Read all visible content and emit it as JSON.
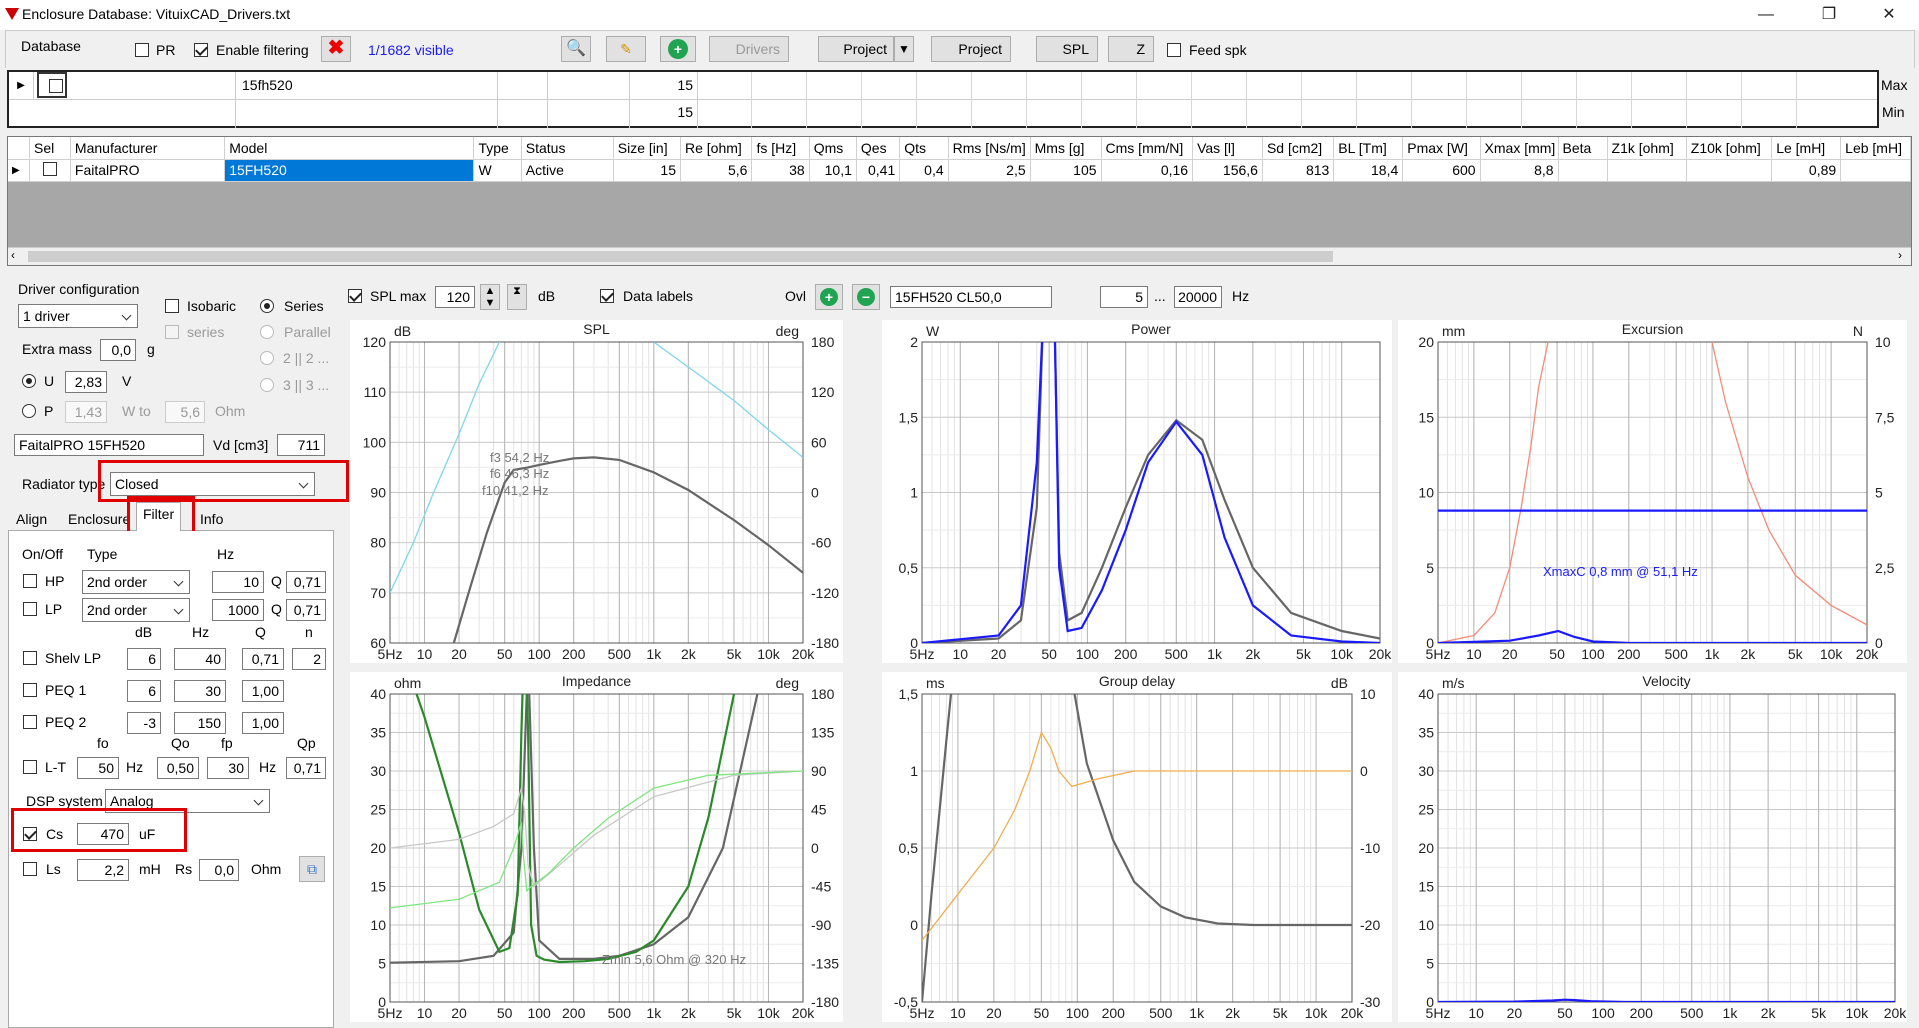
{
  "window": {
    "title": "Enclosure  Database: VituixCAD_Drivers.txt",
    "min": "—",
    "restore": "❐",
    "close": "✕"
  },
  "toolbar": {
    "database": "Database",
    "pr": "PR",
    "enable_filtering": "Enable filtering",
    "visible": "1/1682 visible",
    "drivers": "Drivers",
    "project1": "Project",
    "project2": "Project",
    "spl": "SPL",
    "z": "Z",
    "feed_spk": "Feed spk"
  },
  "filter_grid": {
    "model_filter": "15fh520",
    "size_max": "15",
    "size_min": "15",
    "max": "Max",
    "min": "Min"
  },
  "driver_grid": {
    "headers": [
      "Sel",
      "Manufacturer",
      "Model",
      "Type",
      "Status",
      "Size [in]",
      "Re [ohm]",
      "fs [Hz]",
      "Qms",
      "Qes",
      "Qts",
      "Rms [Ns/m]",
      "Mms [g]",
      "Cms [mm/N]",
      "Vas [l]",
      "Sd [cm2]",
      "BL [Tm]",
      "Pmax [W]",
      "Xmax [mm]",
      "Beta",
      "Z1k [ohm]",
      "Z10k [ohm]",
      "Le [mH]",
      "Leb [mH]"
    ],
    "row": [
      "",
      "FaitalPRO",
      "15FH520",
      "W",
      "Active",
      "15",
      "5,6",
      "38",
      "10,1",
      "0,41",
      "0,4",
      "2,5",
      "105",
      "0,16",
      "156,6",
      "813",
      "18,4",
      "600",
      "8,8",
      "",
      "",
      "",
      "0,89",
      ""
    ]
  },
  "driver_config": {
    "title": "Driver configuration",
    "drivers": "1 driver",
    "isobaric": "Isobaric",
    "series": "Series",
    "series2": "series",
    "parallel": "Parallel",
    "two_two": "2 || 2 ...",
    "three_three": "3 || 3 ...",
    "extra_mass": "Extra mass",
    "extra_mass_val": "0,0",
    "g": "g",
    "u": "U",
    "u_val": "2,83",
    "v": "V",
    "p": "P",
    "p_val": "1,43",
    "w_to": "W to",
    "ohm_val": "5,6",
    "ohm": "Ohm",
    "name": "FaitalPRO 15FH520",
    "vd": "Vd [cm3]",
    "vd_val": "711",
    "radiator_type": "Radiator type",
    "radiator_val": "Closed"
  },
  "tabs": {
    "align": "Align",
    "enclosure": "Enclosure",
    "filter": "Filter",
    "info": "Info"
  },
  "filter": {
    "onoff": "On/Off",
    "type": "Type",
    "hz": "Hz",
    "hp": "HP",
    "hp_type": "2nd order",
    "hp_hz": "10",
    "q": "Q",
    "hp_q": "0,71",
    "lp": "LP",
    "lp_type": "2nd order",
    "lp_hz": "1000",
    "lp_q": "0,71",
    "db": "dB",
    "hz2": "Hz",
    "q2": "Q",
    "n": "n",
    "shelv": "Shelv LP",
    "shelv_db": "6",
    "shelv_hz": "40",
    "shelv_q": "0,71",
    "shelv_n": "2",
    "peq1": "PEQ 1",
    "peq1_db": "6",
    "peq1_hz": "30",
    "peq1_q": "1,00",
    "peq2": "PEQ 2",
    "peq2_db": "-3",
    "peq2_hz": "150",
    "peq2_q": "1,00",
    "fo": "fo",
    "qo": "Qo",
    "fp": "fp",
    "qp": "Qp",
    "lt": "L-T",
    "lt_fo": "50",
    "lt_hz": "Hz",
    "lt_qo": "0,50",
    "lt_fp": "30",
    "lt_hz2": "Hz",
    "lt_qp": "0,71",
    "dsp": "DSP system",
    "dsp_val": "Analog",
    "cs": "Cs",
    "cs_val": "470",
    "uf": "uF",
    "ls": "Ls",
    "ls_val": "2,2",
    "mh": "mH",
    "rs": "Rs",
    "rs_val": "0,0",
    "ohm": "Ohm"
  },
  "chart_toolbar": {
    "spl_max": "SPL max",
    "spl_max_val": "120",
    "db": "dB",
    "data_labels": "Data labels",
    "ovl": "Ovl",
    "ovl_name": "15FH520 CL50,0",
    "f_from": "5",
    "dots": "...",
    "f_to": "20000",
    "hz": "Hz"
  },
  "chart_data": [
    {
      "type": "line",
      "title": "SPL",
      "ylabel": "dB",
      "y2label": "deg",
      "ylim": [
        60,
        120
      ],
      "y2lim": [
        -180,
        180
      ],
      "yticks": [
        "120",
        "110",
        "100",
        "90",
        "80",
        "70",
        "60"
      ],
      "y2ticks": [
        "180",
        "120",
        "60",
        "0",
        "-60",
        "-120",
        "-180"
      ],
      "xticks": [
        "5Hz",
        "10",
        "20",
        "50",
        "100",
        "200",
        "500",
        "1k",
        "2k",
        "5k",
        "10k",
        "20k"
      ],
      "annotations": [
        "f3 54,2 Hz",
        "f6 46,3 Hz",
        "f10 41,2 Hz"
      ],
      "series": [
        {
          "color": "#666",
          "x": [
            18,
            25,
            35,
            50,
            60,
            80,
            100,
            150,
            200,
            300,
            500,
            1000,
            2000,
            5000,
            10000,
            20000
          ],
          "y": [
            60,
            71,
            82,
            92,
            94.5,
            95,
            95.5,
            96.3,
            96.8,
            97,
            96.5,
            94,
            90.5,
            84.5,
            79.5,
            74
          ]
        },
        {
          "color": "#7dd8e6",
          "axis": "y2",
          "x": [
            5,
            8,
            12,
            20,
            30,
            45
          ],
          "y": [
            -120,
            -60,
            0,
            70,
            130,
            180
          ]
        },
        {
          "color": "#7dd8e6",
          "axis": "y2",
          "x": [
            1000,
            2000,
            5000,
            10000,
            20000
          ],
          "y": [
            180,
            150,
            110,
            75,
            42
          ]
        }
      ]
    },
    {
      "type": "line",
      "title": "Power",
      "ylabel": "W",
      "ylim": [
        0,
        2
      ],
      "yticks": [
        "2",
        "1,5",
        "1",
        "0,5",
        "0"
      ],
      "xticks": [
        "5Hz",
        "10",
        "20",
        "50",
        "100",
        "200",
        "500",
        "1k",
        "2k",
        "5k",
        "10k",
        "20k"
      ],
      "series": [
        {
          "color": "#666",
          "x": [
            5,
            20,
            30,
            40,
            45,
            55,
            60,
            70,
            90,
            130,
            200,
            300,
            500,
            800,
            1200,
            2000,
            4000,
            10000,
            20000
          ],
          "y": [
            0,
            0.03,
            0.15,
            0.9,
            2.2,
            2.2,
            0.6,
            0.15,
            0.2,
            0.5,
            0.9,
            1.25,
            1.48,
            1.35,
            0.95,
            0.5,
            0.2,
            0.08,
            0.03
          ]
        },
        {
          "color": "#1a1aff",
          "x": [
            5,
            20,
            30,
            40,
            45,
            55,
            60,
            70,
            90,
            130,
            200,
            300,
            500,
            800,
            1200,
            2000,
            4000,
            10000,
            20000
          ],
          "y": [
            0,
            0.05,
            0.25,
            1.2,
            2.2,
            2.2,
            0.5,
            0.08,
            0.1,
            0.35,
            0.75,
            1.2,
            1.47,
            1.25,
            0.7,
            0.25,
            0.05,
            0.01,
            0
          ]
        }
      ]
    },
    {
      "type": "line",
      "title": "Excursion",
      "ylabel": "mm",
      "y2label": "N",
      "ylim": [
        0,
        20
      ],
      "y2lim": [
        0,
        10
      ],
      "yticks": [
        "20",
        "15",
        "10",
        "5",
        "0"
      ],
      "y2ticks": [
        "10",
        "7,5",
        "5",
        "2,5",
        "0"
      ],
      "xticks": [
        "5Hz",
        "10",
        "20",
        "50",
        "100",
        "200",
        "500",
        "1k",
        "2k",
        "5k",
        "10k",
        "20k"
      ],
      "annotations": [
        "XmaxC 0,8 mm  @ 51,1 Hz"
      ],
      "series": [
        {
          "color": "#f28b7a",
          "x": [
            5,
            10,
            15,
            20,
            25,
            30,
            35,
            42
          ],
          "y": [
            0,
            0.5,
            2,
            5,
            9,
            13,
            17,
            20
          ]
        },
        {
          "color": "#f28b7a",
          "x": [
            1000,
            1300,
            2000,
            3000,
            5000,
            10000,
            20000
          ],
          "y": [
            20,
            16,
            11,
            7.5,
            4.5,
            2.5,
            1.2
          ]
        },
        {
          "color": "#1a1aff",
          "x": [
            5,
            20000
          ],
          "y": [
            8.8,
            8.8
          ]
        },
        {
          "color": "#1a1aff",
          "x": [
            5,
            20,
            35,
            51,
            70,
            100,
            200,
            20000
          ],
          "y": [
            0,
            0.15,
            0.5,
            0.8,
            0.4,
            0.1,
            0,
            0
          ]
        }
      ]
    },
    {
      "type": "line",
      "title": "Impedance",
      "ylabel": "ohm",
      "y2label": "deg",
      "ylim": [
        0,
        40
      ],
      "y2lim": [
        -180,
        180
      ],
      "yticks": [
        "40",
        "35",
        "30",
        "25",
        "20",
        "15",
        "10",
        "5",
        "0"
      ],
      "y2ticks": [
        "180",
        "135",
        "90",
        "45",
        "0",
        "-45",
        "-90",
        "-135",
        "-180"
      ],
      "xticks": [
        "5Hz",
        "10",
        "20",
        "50",
        "100",
        "200",
        "500",
        "1k",
        "2k",
        "5k",
        "10k",
        "20k"
      ],
      "annotations": [
        "Zmin 5,6 Ohm @ 320 Hz"
      ],
      "series": [
        {
          "color": "#666",
          "x": [
            5,
            20,
            40,
            60,
            70,
            80,
            90,
            100,
            150,
            300,
            500,
            1000,
            2000,
            4000,
            8000
          ],
          "y": [
            5.1,
            5.3,
            6,
            9,
            20,
            45,
            20,
            8,
            5.6,
            5.6,
            6,
            7.5,
            11,
            20,
            40
          ]
        },
        {
          "color": "#2a8a2a",
          "x": [
            5,
            10,
            20,
            30,
            45,
            55,
            65,
            70,
            75,
            80,
            85,
            95,
            110,
            150,
            250,
            400,
            700,
            1000,
            2000,
            3000,
            5000
          ],
          "y": [
            50,
            37,
            22,
            12,
            6.5,
            7,
            14,
            35,
            50,
            35,
            10,
            6,
            5.5,
            5.2,
            5.3,
            5.6,
            6.5,
            8,
            15,
            24,
            40
          ]
        },
        {
          "color": "#c8c8c8",
          "axis": "y2",
          "x": [
            5,
            20,
            40,
            60,
            70,
            75,
            80,
            90,
            150,
            300,
            1000,
            5000,
            20000
          ],
          "y": [
            0,
            10,
            25,
            40,
            70,
            40,
            -20,
            -45,
            -20,
            15,
            60,
            85,
            90
          ]
        },
        {
          "color": "#7ee67e",
          "axis": "y2",
          "x": [
            5,
            20,
            45,
            60,
            70,
            73,
            78,
            85,
            120,
            200,
            400,
            1000,
            3000,
            20000
          ],
          "y": [
            -70,
            -60,
            -40,
            0,
            30,
            -10,
            -50,
            -45,
            -30,
            0,
            35,
            70,
            85,
            90
          ]
        }
      ]
    },
    {
      "type": "line",
      "title": "Group delay",
      "ylabel": "ms",
      "y2label": "dB",
      "ylim": [
        -0.5,
        1.5
      ],
      "y2lim": [
        -30,
        10
      ],
      "yticks": [
        "1,5",
        "1",
        "0,5",
        "0",
        "-0,5"
      ],
      "y2ticks": [
        "10",
        "0",
        "-10",
        "-20",
        "-30"
      ],
      "xticks": [
        "5Hz",
        "10",
        "20",
        "50",
        "100",
        "200",
        "500",
        "1k",
        "2k",
        "5k",
        "10k",
        "20k"
      ],
      "series": [
        {
          "color": "#666",
          "x": [
            5,
            6,
            8,
            9
          ],
          "y": [
            -0.5,
            0.2,
            1.2,
            1.6
          ]
        },
        {
          "color": "#666",
          "x": [
            90,
            120,
            200,
            300,
            500,
            800,
            1500,
            3000,
            6000,
            20000
          ],
          "y": [
            1.6,
            1.05,
            0.55,
            0.28,
            0.12,
            0.05,
            0.01,
            0,
            0,
            0
          ]
        },
        {
          "color": "#f0ad4e",
          "axis": "y2",
          "x": [
            5,
            10,
            20,
            30,
            40,
            50,
            60,
            70,
            90,
            150,
            300,
            1000,
            20000
          ],
          "y": [
            -22,
            -16,
            -10,
            -5,
            0,
            5,
            3,
            0,
            -2,
            -1,
            0,
            0,
            0
          ]
        }
      ]
    },
    {
      "type": "line",
      "title": "Velocity",
      "ylabel": "m/s",
      "ylim": [
        0,
        40
      ],
      "yticks": [
        "40",
        "35",
        "30",
        "25",
        "20",
        "15",
        "10",
        "5",
        "0"
      ],
      "xticks": [
        "5Hz",
        "10",
        "20",
        "50",
        "100",
        "200",
        "500",
        "1k",
        "2k",
        "5k",
        "10k",
        "20k"
      ],
      "series": [
        {
          "color": "#1a1aff",
          "x": [
            5,
            20,
            40,
            50,
            60,
            80,
            150,
            20000
          ],
          "y": [
            0,
            0.05,
            0.2,
            0.3,
            0.25,
            0.1,
            0,
            0
          ]
        }
      ]
    }
  ]
}
